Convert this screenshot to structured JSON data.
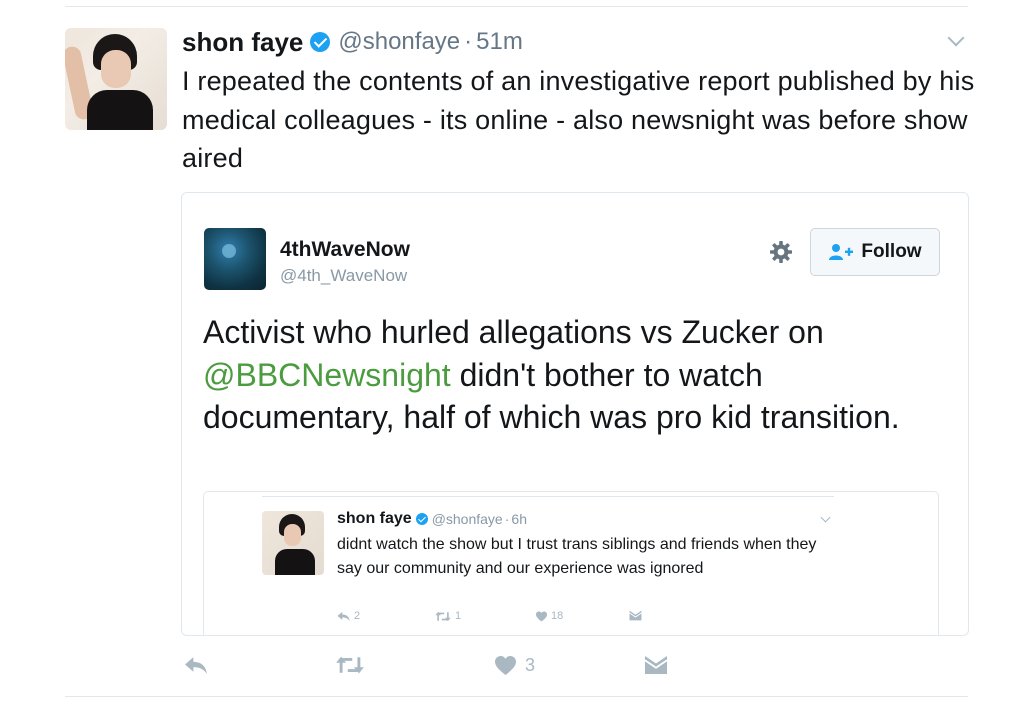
{
  "tweet": {
    "author_name": "shon faye",
    "handle": "@shonfaye",
    "separator": "·",
    "time": "51m",
    "text": "I repeated the contents of an investigative report published by his medical colleagues - its online - also newsnight was before show aired",
    "actions": {
      "reply_count": "",
      "retweet_count": "",
      "like_count": "3"
    }
  },
  "embedded": {
    "author_name": "4thWaveNow",
    "handle": "@4th_WaveNow",
    "follow_label": "Follow",
    "text_before": "Activist who hurled allegations vs Zucker on ",
    "mention": "@BBCNewsnight",
    "text_after": " didn't bother to watch documentary, half of which was pro kid transition.",
    "quoted": {
      "author_name": "shon faye",
      "handle": "@shonfaye",
      "separator": "·",
      "time": "6h",
      "text": "didnt watch the show but I trust trans siblings and friends when they say our community and our experience was ignored",
      "reply_count": "2",
      "retweet_count": "1",
      "like_count": "18"
    }
  },
  "colors": {
    "verified": "#1da1f2",
    "mention": "#4a9c3e",
    "muted": "#657786",
    "action_icon": "#aab8c2",
    "divider": "#e1e8ed"
  },
  "icons": [
    "verified-badge-icon",
    "chevron-down-icon",
    "gear-icon",
    "follow-person-icon",
    "reply-icon",
    "retweet-icon",
    "like-heart-icon",
    "direct-message-icon"
  ]
}
